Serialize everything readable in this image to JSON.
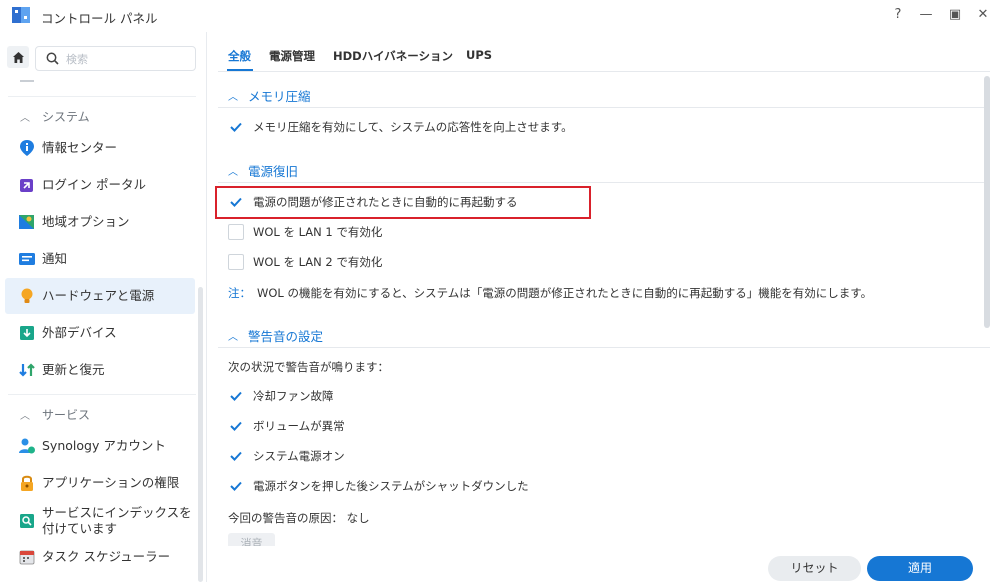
{
  "window": {
    "title": "コントロール パネル",
    "controls": {
      "help": "?",
      "minimize": "—",
      "maximize": "▣",
      "close": "✕"
    }
  },
  "sidebar": {
    "search_placeholder": "検索",
    "sections": [
      {
        "label": "システム",
        "items": [
          {
            "label": "情報センター",
            "icon": "info-icon"
          },
          {
            "label": "ログイン ポータル",
            "icon": "login-portal-icon"
          },
          {
            "label": "地域オプション",
            "icon": "regional-options-icon"
          },
          {
            "label": "通知",
            "icon": "notification-icon"
          },
          {
            "label": "ハードウェアと電源",
            "icon": "hardware-power-icon",
            "active": true
          },
          {
            "label": "外部デバイス",
            "icon": "external-devices-icon"
          },
          {
            "label": "更新と復元",
            "icon": "update-restore-icon"
          }
        ]
      },
      {
        "label": "サービス",
        "items": [
          {
            "label": "Synology アカウント",
            "icon": "synology-account-icon"
          },
          {
            "label": "アプリケーションの権限",
            "icon": "app-privileges-icon"
          },
          {
            "label": "サービスにインデックスを付けています",
            "icon": "indexing-service-icon"
          },
          {
            "label": "タスク スケジューラー",
            "icon": "task-scheduler-icon"
          }
        ]
      }
    ]
  },
  "tabs": [
    {
      "label": "全般",
      "active": true
    },
    {
      "label": "電源管理"
    },
    {
      "label": "HDDハイバネーション"
    },
    {
      "label": "UPS"
    }
  ],
  "groups": {
    "memory": {
      "title": "メモリ圧縮",
      "option": {
        "label": "メモリ圧縮を有効にして、システムの応答性を向上させます。",
        "checked": true
      }
    },
    "power_recovery": {
      "title": "電源復旧",
      "options": [
        {
          "label": "電源の問題が修正されたときに自動的に再起動する",
          "checked": true
        },
        {
          "label": "WOL を LAN 1 で有効化",
          "checked": false
        },
        {
          "label": "WOL を LAN 2 で有効化",
          "checked": false
        }
      ],
      "note_prefix": "注：",
      "note": "WOL の機能を有効にすると、システムは「電源の問題が修正されたときに自動的に再起動する」機能を有効にします。"
    },
    "beep": {
      "title": "警告音の設定",
      "intro": "次の状況で警告音が鳴ります：",
      "options": [
        {
          "label": "冷却ファン故障",
          "checked": true
        },
        {
          "label": "ボリュームが異常",
          "checked": true
        },
        {
          "label": "システム電源オン",
          "checked": true
        },
        {
          "label": "電源ボタンを押した後システムがシャットダウンした",
          "checked": true
        }
      ],
      "cause": "今回の警告音の原因： なし",
      "clear_label": "消音"
    }
  },
  "footer": {
    "reset_label": "リセット",
    "apply_label": "適用"
  },
  "colors": {
    "accent": "#1677d4",
    "highlight": "#d9212b"
  }
}
